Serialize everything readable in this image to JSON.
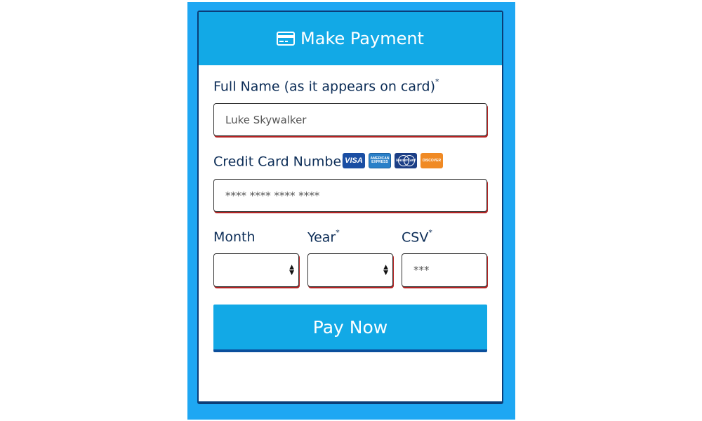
{
  "header": {
    "title": "Make Payment",
    "icon": "credit-card-icon"
  },
  "fields": {
    "full_name": {
      "label": "Full Name (as it appears on card)",
      "required_mark": "*",
      "placeholder": "Luke Skywalker"
    },
    "card_number": {
      "label": "Credit Card Number",
      "required_mark": "*",
      "placeholder": "**** **** **** ****"
    },
    "month": {
      "label": "Month"
    },
    "year": {
      "label": "Year",
      "required_mark": "*"
    },
    "csv": {
      "label": "CSV",
      "required_mark": "*",
      "placeholder": "***"
    }
  },
  "card_logos": {
    "visa": "VISA",
    "amex_line1": "AMERICAN",
    "amex_line2": "EXPRESS",
    "mastercard": "MasterCard",
    "discover": "DISCOVER"
  },
  "submit": {
    "label": "Pay Now"
  },
  "colors": {
    "frame": "#1ea7f3",
    "header": "#12a9e6",
    "text": "#0c2d57",
    "field_shadow": "#b32323",
    "button_border": "#0b4f9c"
  }
}
